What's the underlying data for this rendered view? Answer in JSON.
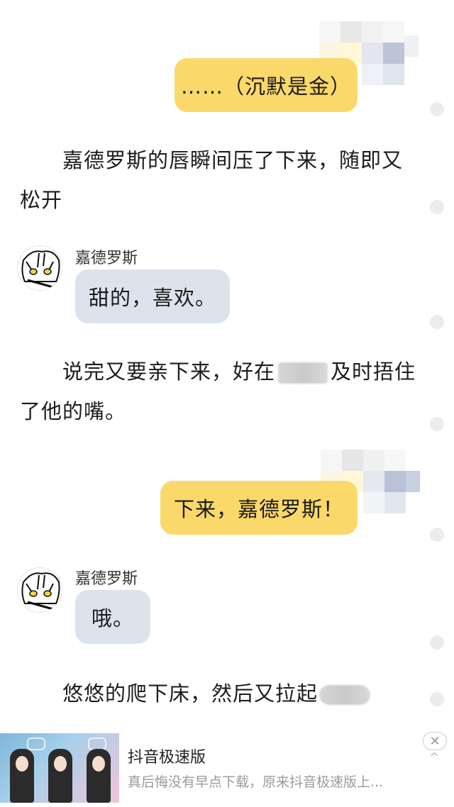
{
  "messages": {
    "me_1": "……（沉默是金）",
    "narration_1": "嘉德罗斯的唇瞬间压了下来，随即又松开",
    "speaker_1": "嘉德罗斯",
    "other_1": "甜的，喜欢。",
    "narration_2_a": "说完又要亲下来，好在",
    "narration_2_b": "及时捂住了他的嘴。",
    "me_2": "下来，嘉德罗斯！",
    "speaker_2": "嘉德罗斯",
    "other_2": "哦。",
    "narration_3": "悠悠的爬下床，然后又拉起"
  },
  "ad": {
    "title": "抖音极速版",
    "description": "真后悔没有早点下载，原来抖音极速版上...",
    "close_icon": "✕",
    "expand_icon": "^"
  },
  "colors": {
    "my_bubble": "#fbd86a",
    "other_bubble": "#dde3ec"
  }
}
